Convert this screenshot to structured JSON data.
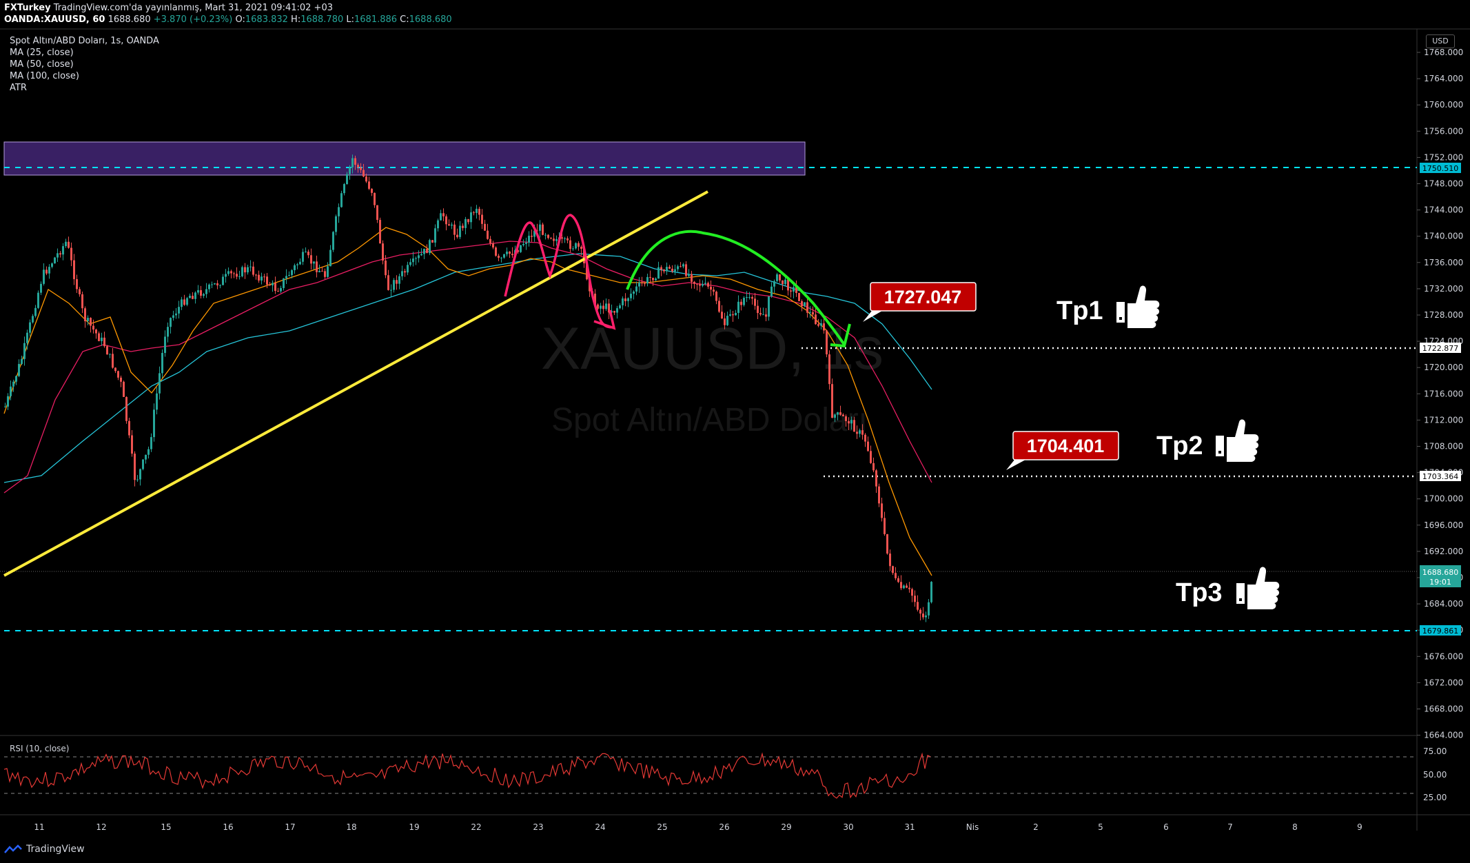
{
  "header": {
    "author": "FXTurkey",
    "published_text": "TradingView.com'da yayınlanmış, Mart 31, 2021 09:41:02 +03",
    "symbol": "OANDA:XAUUSD, 60",
    "last": "1688.680",
    "change": "+3.870 (+0.23%)",
    "open_label": "O:",
    "open": "1683.832",
    "high_label": "H:",
    "high": "1688.780",
    "low_label": "L:",
    "low": "1681.886",
    "close_label": "C:",
    "close": "1688.680"
  },
  "legend": {
    "title": "Spot Altın/ABD Doları, 1s, OANDA",
    "ma25": "MA (25, close)",
    "ma50": "MA (50, close)",
    "ma100": "MA (100, close)",
    "atr": "ATR"
  },
  "watermark": {
    "symbol": "XAUUSD, 1s",
    "name": "Spot Altın/ABD Doları"
  },
  "currency_button": "USD",
  "price_axis": [
    "1768.000",
    "1764.000",
    "1760.000",
    "1756.000",
    "1752.000",
    "1748.000",
    "1744.000",
    "1740.000",
    "1736.000",
    "1732.000",
    "1728.000",
    "1724.000",
    "1720.000",
    "1716.000",
    "1712.000",
    "1708.000",
    "1704.000",
    "1700.000",
    "1696.000",
    "1692.000",
    "1688.000",
    "1684.000",
    "1680.000",
    "1676.000",
    "1672.000",
    "1668.000",
    "1664.000"
  ],
  "price_tags": {
    "resistance": "1750.510",
    "tp1_level": "1722.877",
    "tp2_level": "1703.364",
    "current": "1688.680",
    "countdown": "19:01",
    "support": "1679.861"
  },
  "callouts": {
    "tp1_price": "1727.047",
    "tp2_price": "1704.401"
  },
  "targets": {
    "tp1": "Tp1",
    "tp2": "Tp2",
    "tp3": "Tp3"
  },
  "rsi": {
    "label": "RSI (10, close)",
    "axis": [
      "75.00",
      "50.00",
      "25.00"
    ]
  },
  "time_axis": [
    "11",
    "12",
    "15",
    "16",
    "17",
    "18",
    "19",
    "22",
    "23",
    "24",
    "25",
    "26",
    "29",
    "30",
    "31",
    "Nis",
    "2",
    "5",
    "6",
    "7",
    "8",
    "9"
  ],
  "footer": {
    "brand": "TradingView"
  },
  "colors": {
    "background": "#000000",
    "bull": "#26a69a",
    "bear": "#ef5350",
    "ma25": "#ff9800",
    "ma50": "#e91e63",
    "ma100": "#26c6da",
    "trendline": "#ffeb3b",
    "zone": "#673ab7",
    "dashed_levels": "#00e5ff",
    "callout": "#c00000"
  },
  "icons": [
    "thumbs-up-icon",
    "tradingview-logo-icon"
  ]
}
